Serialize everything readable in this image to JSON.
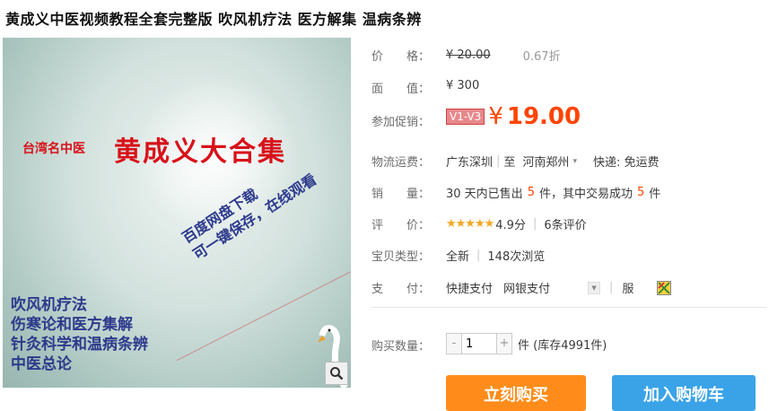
{
  "title": "黄成义中医视频教程全套完整版 吹风机疗法 医方解集 温病条辨",
  "gallery": {
    "tag_small": "台湾名中医",
    "tag_big": "黄成义大合集",
    "diag_line1": "百度网盘下载",
    "diag_line2": "可一键保存，在线观看",
    "list": [
      "吹风机疗法",
      "伤寒论和医方集解",
      "针灸科学和温病条辨",
      "中医总论"
    ]
  },
  "price": {
    "label_a": "价",
    "label_b": "格：",
    "original": "¥ 20.00",
    "discount": "0.67折"
  },
  "face_value": {
    "label_a": "面",
    "label_b": "值：",
    "value": "¥ 300"
  },
  "promo": {
    "label": "参加促销：",
    "badge": "V1-V3",
    "currency": "¥",
    "price": "19.00"
  },
  "shipping": {
    "label": "物流运费：",
    "from": "广东深圳",
    "to_word": "至",
    "to": "河南郑州",
    "method": "快递: 免运费"
  },
  "sales": {
    "label_a": "销",
    "label_b": "量：",
    "prefix": "30 天内已售出",
    "sold": "5",
    "mid": "件，其中交易成功",
    "success": "5",
    "suffix": "件"
  },
  "rating": {
    "label_a": "评",
    "label_b": "价：",
    "stars": "★★★★★",
    "score": "4.9分",
    "reviews": "6条评价"
  },
  "type": {
    "label": "宝贝类型：",
    "condition": "全新",
    "views": "148次浏览"
  },
  "payment": {
    "label_a": "支",
    "label_b": "付：",
    "opt1": "快捷支付",
    "opt2": "网银支付",
    "service": "服"
  },
  "quantity": {
    "label": "购买数量：",
    "minus": "-",
    "value": "1",
    "plus": "+",
    "stock": "件 (库存4991件)"
  },
  "buttons": {
    "buy": "立刻购买",
    "cart": "加入购物车"
  },
  "colors": {
    "accent": "#ff4400",
    "buy": "#ff8c1a",
    "cart": "#3aa3e8",
    "badge": "#e8888b"
  }
}
